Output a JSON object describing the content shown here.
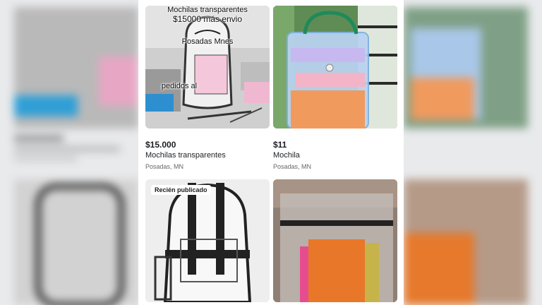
{
  "listings": [
    {
      "price": "$15.000",
      "title": "Mochilas transparentes",
      "location": "Posadas, MN",
      "overlay": {
        "line1": "Mochilas transparentes",
        "line2": "$15000 más envio",
        "line3": "Posadas Mnes",
        "line4": "pedidos al"
      }
    },
    {
      "price": "$11",
      "title": "Mochila",
      "location": "Posadas, MN"
    },
    {
      "badge": "Recién publicado"
    },
    {}
  ]
}
